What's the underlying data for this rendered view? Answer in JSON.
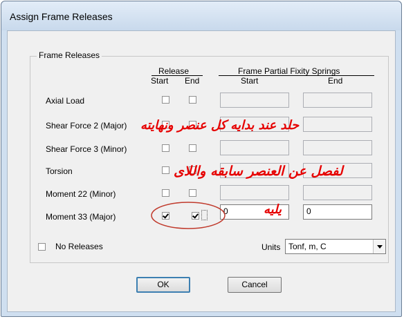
{
  "window": {
    "title": "Assign Frame Releases"
  },
  "group": {
    "title": "Frame Releases"
  },
  "headers": {
    "release": "Release",
    "start": "Start",
    "end": "End",
    "springs": "Frame Partial Fixity Springs",
    "spring_start": "Start",
    "spring_end": "End"
  },
  "rows": [
    {
      "label": "Axial Load",
      "start_checked": false,
      "end_checked": false,
      "spring_start": "",
      "spring_end": ""
    },
    {
      "label": "Shear Force 2 (Major)",
      "start_checked": false,
      "end_checked": false,
      "spring_start": "",
      "spring_end": ""
    },
    {
      "label": "Shear Force 3 (Minor)",
      "start_checked": false,
      "end_checked": false,
      "spring_start": "",
      "spring_end": ""
    },
    {
      "label": "Torsion",
      "start_checked": false,
      "end_checked": false,
      "spring_start": "",
      "spring_end": ""
    },
    {
      "label": "Moment 22 (Minor)",
      "start_checked": false,
      "end_checked": false,
      "spring_start": "",
      "spring_end": ""
    },
    {
      "label": "Moment 33 (Major)",
      "start_checked": true,
      "end_checked": true,
      "spring_start": "0",
      "spring_end": "0"
    }
  ],
  "no_releases": {
    "label": "No Releases",
    "checked": false
  },
  "units": {
    "label": "Units",
    "value": "Tonf, m, C"
  },
  "buttons": {
    "ok": "OK",
    "cancel": "Cancel"
  },
  "annotation": {
    "color": "#e60000",
    "line1": "حلد عند بدايه كل عنصر ونهايته",
    "line2": "لفصل عن العنصر سابقه واللاى",
    "line3": "يليه"
  }
}
